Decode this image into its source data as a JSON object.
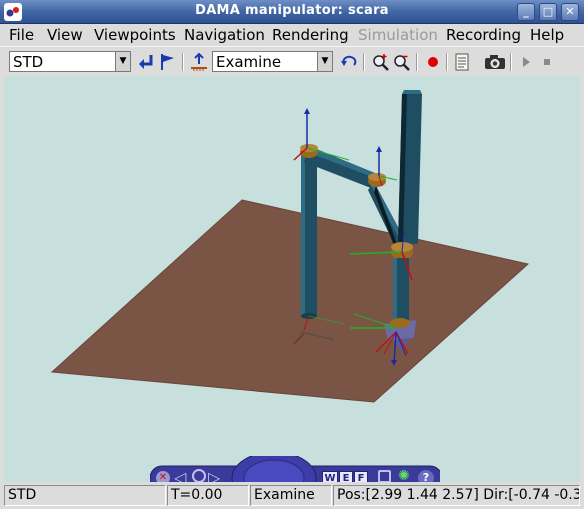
{
  "window": {
    "title": "DAMA manipulator: scara"
  },
  "menu": [
    {
      "label": "File"
    },
    {
      "label": "View"
    },
    {
      "label": "Viewpoints"
    },
    {
      "label": "Navigation"
    },
    {
      "label": "Rendering"
    },
    {
      "label": "Simulation",
      "disabled": true
    },
    {
      "label": "Recording"
    },
    {
      "label": "Help"
    }
  ],
  "toolbar": {
    "viewpoint_value": "STD",
    "navigation_mode_value": "Examine",
    "icons": [
      "return-icon",
      "flag-icon",
      "align-icon",
      "undo-view-icon",
      "zoom-in-icon",
      "zoom-out-icon",
      "record-icon",
      "notes-icon",
      "camera-icon",
      "play-icon",
      "stop-icon"
    ],
    "record_color": "#e00000"
  },
  "navigator": {
    "buttons": [
      "W",
      "E",
      "F"
    ],
    "icons": [
      "close-icon",
      "left-arrow-icon",
      "orbit-icon",
      "right-arrow-icon",
      "joystick-icon",
      "fit-view-icon",
      "headlight-icon",
      "help-icon"
    ]
  },
  "status": {
    "viewpoint": "STD",
    "time": "T=0.00",
    "mode": "Examine",
    "position": "Pos:[2.99 1.44 2.57] Dir:[-0.74 -0.3"
  },
  "colors": {
    "background": "#c7e0de",
    "floor": "#7a5546",
    "links": "#1f4e63",
    "joints": "#9a6b1e"
  }
}
